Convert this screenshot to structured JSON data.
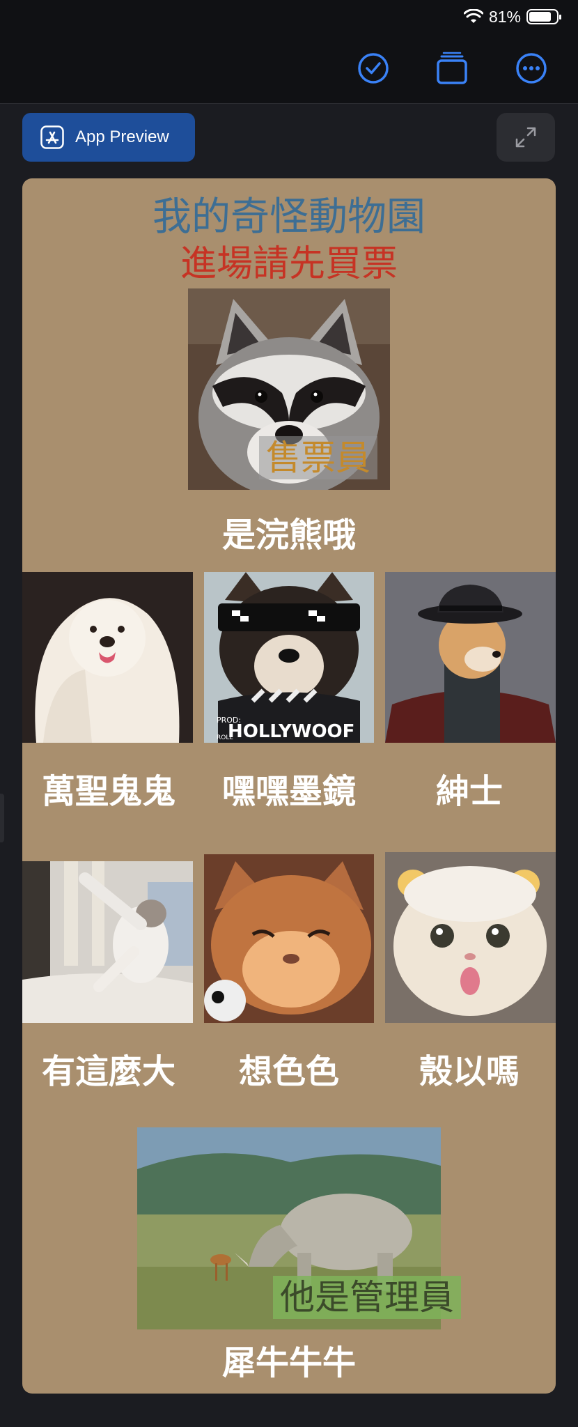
{
  "status": {
    "battery": "81%",
    "battery_level": 0.81
  },
  "toolbar": {
    "icons": [
      "checkmark-circle-icon",
      "window-stack-icon",
      "more-circle-icon"
    ]
  },
  "preview": {
    "label": "App Preview"
  },
  "zoo": {
    "title": "我的奇怪動物園",
    "subtitle": "進場請先買票",
    "raccoon": {
      "badge": "售票員",
      "caption": "是浣熊哦"
    },
    "dogs": [
      "萬聖鬼鬼",
      "嘿嘿墨鏡",
      "紳士"
    ],
    "cats": [
      "有這麼大",
      "想色色",
      "殼以嗎"
    ],
    "rhino": {
      "badge": "他是管理員",
      "caption": "犀牛牛牛"
    },
    "prints": {
      "hollywoof": "HOLLYWOOF",
      "prod": "PROD:",
      "roll": "ROLL"
    }
  },
  "colors": {
    "card_background": "#a98f6e",
    "title_color": "#3d6e94",
    "subtitle_color": "#c63324",
    "ticket_badge_text": "#c48a2c",
    "manager_badge_bg": "#7fb35b",
    "accent_blue": "#3a82f7"
  }
}
